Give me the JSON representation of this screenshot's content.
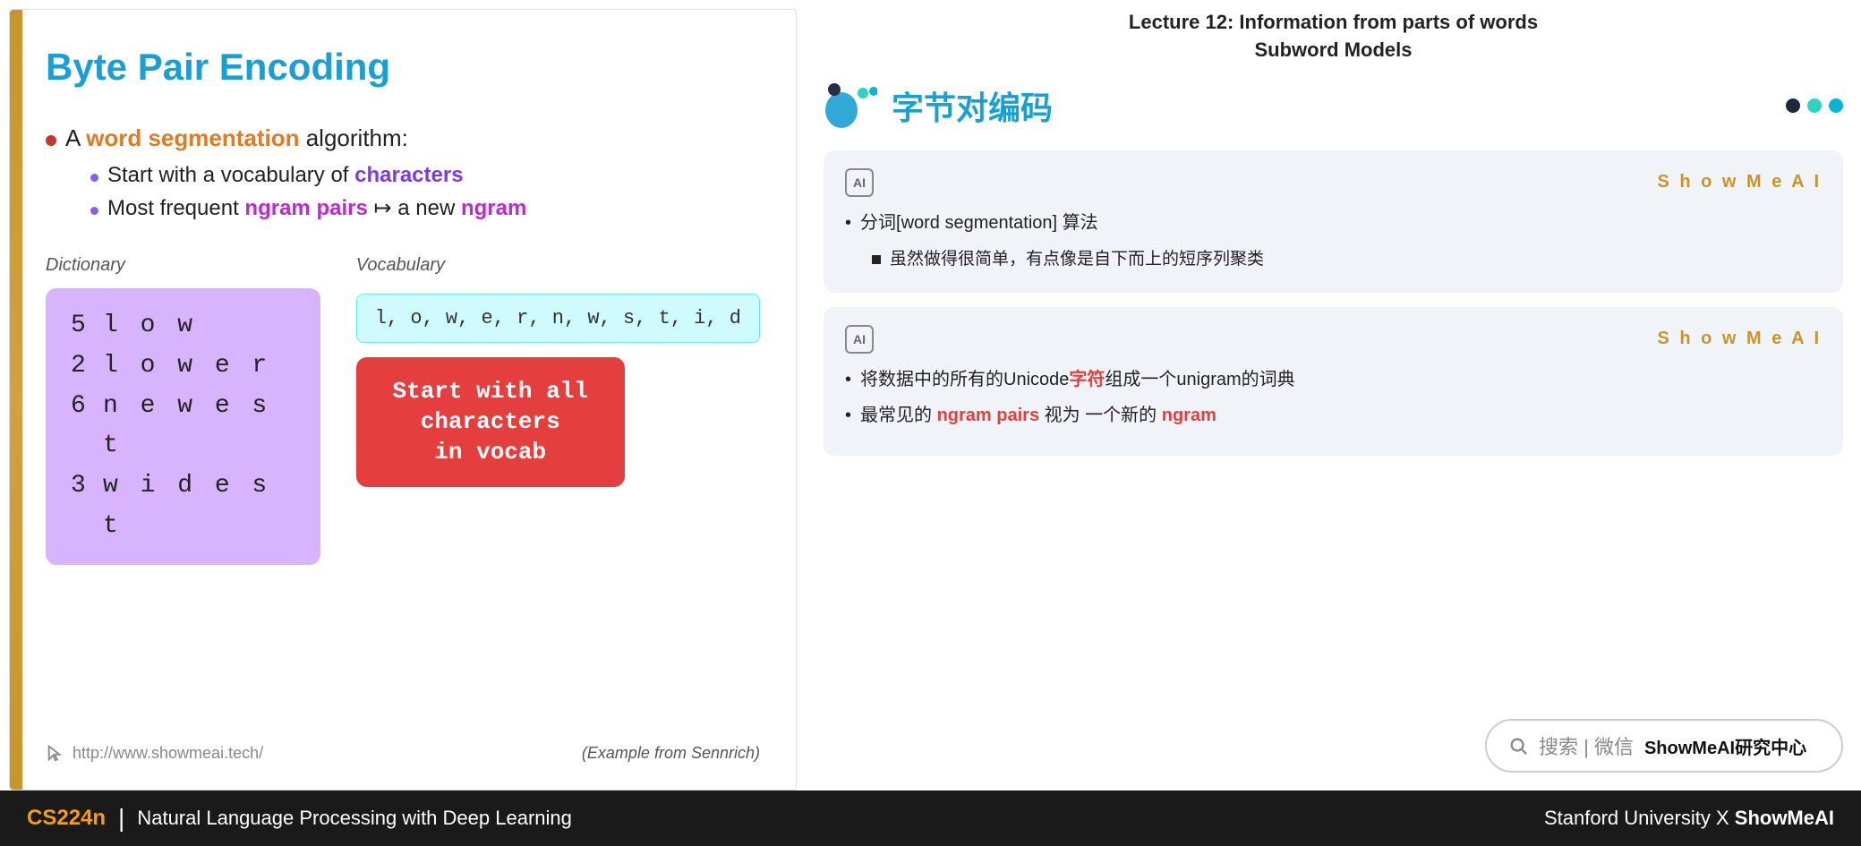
{
  "slide": {
    "title": "Byte Pair Encoding",
    "bullet_main": "A ",
    "highlight_word_seg": "word segmentation",
    "bullet_main_rest": " algorithm:",
    "sub_bullets": [
      {
        "text_before": "Start with a vocabulary of ",
        "highlight": "characters",
        "text_after": ""
      },
      {
        "text_before": "Most frequent ",
        "highlight1": "ngram pairs",
        "text_middle": " ↦ a new ",
        "highlight2": "ngram",
        "text_after": ""
      }
    ],
    "dict_label": "Dictionary",
    "dict_entries": [
      {
        "num": "5",
        "word": "l o w"
      },
      {
        "num": "2",
        "word": "l o w e r"
      },
      {
        "num": "6",
        "word": "n e w e s t"
      },
      {
        "num": "3",
        "word": "w i d e s t"
      }
    ],
    "vocab_label": "Vocabulary",
    "vocab_chars": "l, o, w, e, r, n, w, s, t, i, d",
    "start_vocab_btn": "Start with all characters in vocab",
    "url": "http://www.showmeai.tech/",
    "example_note": "(Example from Sennrich)"
  },
  "right": {
    "lecture_title_line1": "Lecture 12: Information from parts of words",
    "lecture_title_line2": "Subword Models",
    "chinese_title": "字节对编码",
    "brand": "ShowMeAI",
    "card1": {
      "ai_label": "AI",
      "brand": "S h o w M e A I",
      "bullet1": "分词[word segmentation] 算法",
      "sub1": "虽然做得很简单，有点像是自下而上的短序列聚类"
    },
    "card2": {
      "ai_label": "AI",
      "brand": "S h o w M e A I",
      "bullet1_before": "将数据中的所有的Unicode",
      "bullet1_highlight": "字符",
      "bullet1_after": "组成一个unigram的词典",
      "bullet2_before": "最常见的 ",
      "bullet2_highlight1": "ngram pairs",
      "bullet2_middle": " 视为 一个新的 ",
      "bullet2_highlight2": "ngram"
    },
    "search_bar": {
      "icon": "🔍",
      "text_plain": "搜索 | 微信 ",
      "text_bold": "ShowMeAI研究中心"
    }
  },
  "bottom_bar": {
    "cs224n": "CS224n",
    "divider": "|",
    "subtitle": "Natural Language Processing with Deep Learning",
    "right_text": "Stanford University",
    "right_x": "X",
    "right_brand": "ShowMeAI"
  }
}
